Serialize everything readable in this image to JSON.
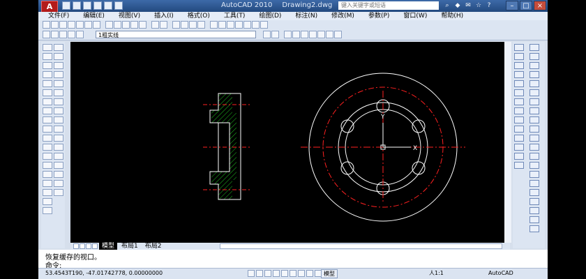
{
  "app": {
    "logo_letter": "A",
    "name": "AutoCAD 2010",
    "document": "Drawing2.dwg",
    "help_search_placeholder": "键入关键字或短语"
  },
  "menus": [
    "文件(F)",
    "编辑(E)",
    "视图(V)",
    "插入(I)",
    "格式(O)",
    "工具(T)",
    "绘图(D)",
    "标注(N)",
    "修改(M)",
    "参数(P)",
    "窗口(W)",
    "帮助(H)"
  ],
  "layer_dropdown": {
    "value": "1粗实线"
  },
  "layout_tabs": [
    "模型",
    "布局1",
    "布局2"
  ],
  "command_line": {
    "history": "恢复缓存的视口。",
    "prompt": "命令:"
  },
  "status": {
    "coordinates": "53.4543T190,  -47.01742778, 0.00000000",
    "model_button": "模型",
    "annotation_scale": "人1:1",
    "workspace": "AutoCAD"
  },
  "drawing": {
    "ucs_x": "X",
    "ucs_y": "Y",
    "line_color": "#ffffff",
    "center_color": "#ff2020",
    "hatch_color": "#20c020"
  }
}
